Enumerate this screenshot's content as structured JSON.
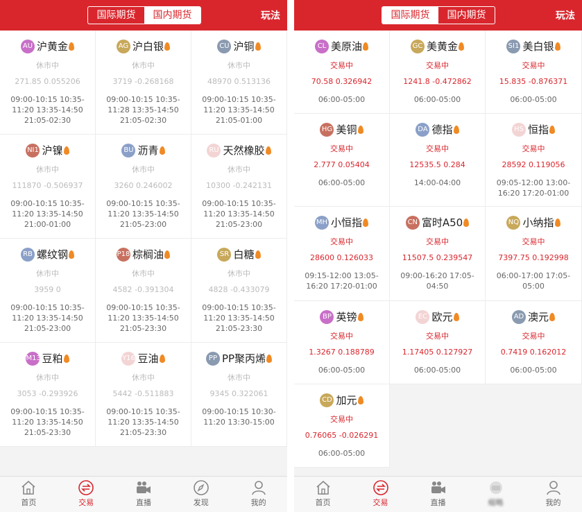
{
  "left": {
    "tabs": [
      "国际期货",
      "国内期货"
    ],
    "active_tab": 1,
    "rules": "玩法",
    "items": [
      {
        "code": "AU",
        "name": "沪黄金",
        "color": "#c86fc8",
        "status": "休市中",
        "quote": "271.85 0.055206",
        "hours": "09:00-10:15 10:35-11:20 13:35-14:50 21:05-02:30"
      },
      {
        "code": "AG",
        "name": "沪白银",
        "color": "#c8a85a",
        "status": "休市中",
        "quote": "3719 -0.268168",
        "hours": "09:00-10:15 10:35-11:28 13:35-14:50 21:05-02:30"
      },
      {
        "code": "CU",
        "name": "沪铜",
        "color": "#8a9ab0",
        "status": "休市中",
        "quote": "48970 0.513136",
        "hours": "09:00-10:15 10:35-11:20 13:35-14:50 21:05-01:00"
      },
      {
        "code": "NI1",
        "name": "沪镍",
        "color": "#c87060",
        "status": "休市中",
        "quote": "111870 -0.506937",
        "hours": "09:00-10:15 10:35-11:20 13:35-14:50 21:00-01:00"
      },
      {
        "code": "BU",
        "name": "沥青",
        "color": "#8aa0c8",
        "status": "休市中",
        "quote": "3260 0.246002",
        "hours": "09:00-10:15 10:35-11:20 13:35-14:50 21:05-23:00"
      },
      {
        "code": "RU",
        "name": "天然橡胶",
        "color": "#f3d4d4",
        "status": "休市中",
        "quote": "10300 -0.242131",
        "hours": "09:00-10:15 10:35-11:20 13:35-14:50 21:05-23:00"
      },
      {
        "code": "RB",
        "name": "螺纹钢",
        "color": "#8aa0c8",
        "status": "休市中",
        "quote": "3959 0",
        "hours": "09:00-10:15 10:35-11:20 13:35-14:50 21:05-23:00"
      },
      {
        "code": "P18",
        "name": "棕榈油",
        "color": "#c87060",
        "status": "休市中",
        "quote": "4582 -0.391304",
        "hours": "09:00-10:15 10:35-11:20 13:35-14:50 21:05-23:30"
      },
      {
        "code": "SR",
        "name": "白糖",
        "color": "#c8a85a",
        "status": "休市中",
        "quote": "4828 -0.433079",
        "hours": "09:00-10:15 10:35-11:20 13:35-14:50 21:05-23:30"
      },
      {
        "code": "M13",
        "name": "豆粕",
        "color": "#c86fc8",
        "status": "休市中",
        "quote": "3053 -0.293926",
        "hours": "09:00-10:15 10:35-11:20 13:35-14:50 21:05-23:30"
      },
      {
        "code": "Y16",
        "name": "豆油",
        "color": "#f3d4d4",
        "status": "休市中",
        "quote": "5442 -0.511883",
        "hours": "09:00-10:15 10:35-11:20 13:35-14:50 21:05-23:30"
      },
      {
        "code": "PP",
        "name": "PP聚丙烯",
        "color": "#8a9ab0",
        "status": "休市中",
        "quote": "9345 0.322061",
        "hours": "09:00-10:15 10:30-11:20 13:30-15:00"
      }
    ],
    "nav": [
      {
        "label": "首页",
        "icon": "home"
      },
      {
        "label": "交易",
        "icon": "trade"
      },
      {
        "label": "直播",
        "icon": "live"
      },
      {
        "label": "发现",
        "icon": "discover"
      },
      {
        "label": "我的",
        "icon": "user"
      }
    ],
    "active_nav": 1
  },
  "right": {
    "tabs": [
      "国际期货",
      "国内期货"
    ],
    "active_tab": 0,
    "rules": "玩法",
    "items": [
      {
        "code": "CL",
        "name": "美原油",
        "color": "#c86fc8",
        "status": "交易中",
        "quote": "70.58 0.326942",
        "hours": "06:00-05:00"
      },
      {
        "code": "GC",
        "name": "美黄金",
        "color": "#c8a85a",
        "status": "交易中",
        "quote": "1241.8 -0.472862",
        "hours": "06:00-05:00"
      },
      {
        "code": "SI1",
        "name": "美白银",
        "color": "#8a9ab0",
        "status": "交易中",
        "quote": "15.835 -0.876371",
        "hours": "06:00-05:00"
      },
      {
        "code": "HG",
        "name": "美铜",
        "color": "#c87060",
        "status": "交易中",
        "quote": "2.777 0.05404",
        "hours": "06:00-05:00"
      },
      {
        "code": "DA",
        "name": "德指",
        "color": "#8aa0c8",
        "status": "交易中",
        "quote": "12535.5 0.284",
        "hours": "14:00-04:00"
      },
      {
        "code": "HS",
        "name": "恒指",
        "color": "#f3d4d4",
        "status": "交易中",
        "quote": "28592 0.119056",
        "hours": "09:05-12:00 13:00-16:20 17:20-01:00"
      },
      {
        "code": "MH",
        "name": "小恒指",
        "color": "#8aa0c8",
        "status": "交易中",
        "quote": "28600 0.126033",
        "hours": "09:15-12:00 13:05-16:20 17:20-01:00"
      },
      {
        "code": "CN",
        "name": "富时A50",
        "color": "#c87060",
        "status": "交易中",
        "quote": "11507.5 0.239547",
        "hours": "09:00-16:20 17:05-04:50"
      },
      {
        "code": "NQ",
        "name": "小纳指",
        "color": "#c8a85a",
        "status": "交易中",
        "quote": "7397.75 0.192998",
        "hours": "06:00-17:00 17:05-05:00"
      },
      {
        "code": "BP",
        "name": "英镑",
        "color": "#c86fc8",
        "status": "交易中",
        "quote": "1.3267 0.188789",
        "hours": "06:00-05:00"
      },
      {
        "code": "EC",
        "name": "欧元",
        "color": "#f3d4d4",
        "status": "交易中",
        "quote": "1.17405 0.127927",
        "hours": "06:00-05:00"
      },
      {
        "code": "AD",
        "name": "澳元",
        "color": "#8a9ab0",
        "status": "交易中",
        "quote": "0.7419 0.162012",
        "hours": "06:00-05:00"
      },
      {
        "code": "CD",
        "name": "加元",
        "color": "#c8a85a",
        "status": "交易中",
        "quote": "0.76065 -0.026291",
        "hours": "06:00-05:00"
      }
    ],
    "nav": [
      {
        "label": "首页",
        "icon": "home"
      },
      {
        "label": "交易",
        "icon": "trade"
      },
      {
        "label": "直播",
        "icon": "live"
      },
      {
        "label": "缩略",
        "icon": "blurred"
      },
      {
        "label": "我的",
        "icon": "user"
      }
    ],
    "active_nav": 1
  }
}
